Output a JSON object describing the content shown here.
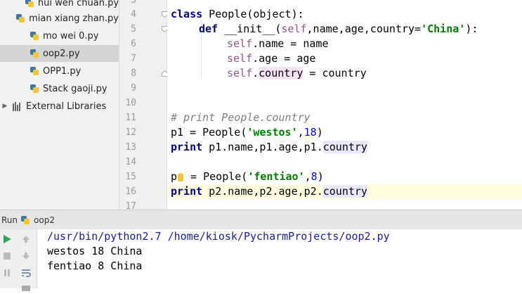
{
  "project_tree": {
    "items": [
      {
        "label": "hui wen chuan.py",
        "selected": false
      },
      {
        "label": "mian xiang zhan.py",
        "selected": false
      },
      {
        "label": "mo wei 0.py",
        "selected": false
      },
      {
        "label": "oop2.py",
        "selected": true
      },
      {
        "label": "OPP1.py",
        "selected": false
      },
      {
        "label": "Stack gaoji.py",
        "selected": false
      }
    ],
    "external_libraries": "External Libraries"
  },
  "editor": {
    "line_numbers": [
      "3",
      "4",
      "5",
      "6",
      "7",
      "8",
      "9",
      "10",
      "11",
      "12",
      "13",
      "14",
      "15",
      "16",
      "17"
    ],
    "current_line": "16",
    "code": {
      "l4_class": "class",
      "l4_rest": " People(object):",
      "l5_def": "def",
      "l5_name": " __init__(",
      "l5_self": "self",
      "l5_params": ",name,age,country=",
      "l5_str": "'China'",
      "l5_end": "):",
      "l6_self": "self",
      "l6_rest": ".name = name",
      "l7_self": "self",
      "l7_rest": ".age = age",
      "l8_self": "self",
      "l8_dot": ".",
      "l8_country": "country",
      "l8_rest": " = country",
      "l11_comment": "# print People.country",
      "l12_start": "p1 = People(",
      "l12_str": "'westos'",
      "l12_comma": ",",
      "l12_num": "18",
      "l12_end": ")",
      "l13_print": "print",
      "l13_rest": " p1.name,p1.age,p1.",
      "l13_country": "country",
      "l15_p": "p",
      "l15_rest": " = People(",
      "l15_str": "'fentiao'",
      "l15_comma": ",",
      "l15_num": "8",
      "l15_end": ")",
      "l16_print": "print",
      "l16_rest": " p2.name,p2.age,p2.",
      "l16_country": "country"
    }
  },
  "run_panel": {
    "label": "Run",
    "config": "oop2",
    "output": [
      "/usr/bin/python2.7 /home/kiosk/PycharmProjects/oop2.py",
      "westos 18 China",
      "fentiao 8 China"
    ]
  },
  "colors": {
    "keyword": "#000080",
    "self": "#94558d",
    "string": "#008000",
    "number": "#0000ff",
    "comment": "#808080",
    "run_green": "#2ea44f"
  }
}
